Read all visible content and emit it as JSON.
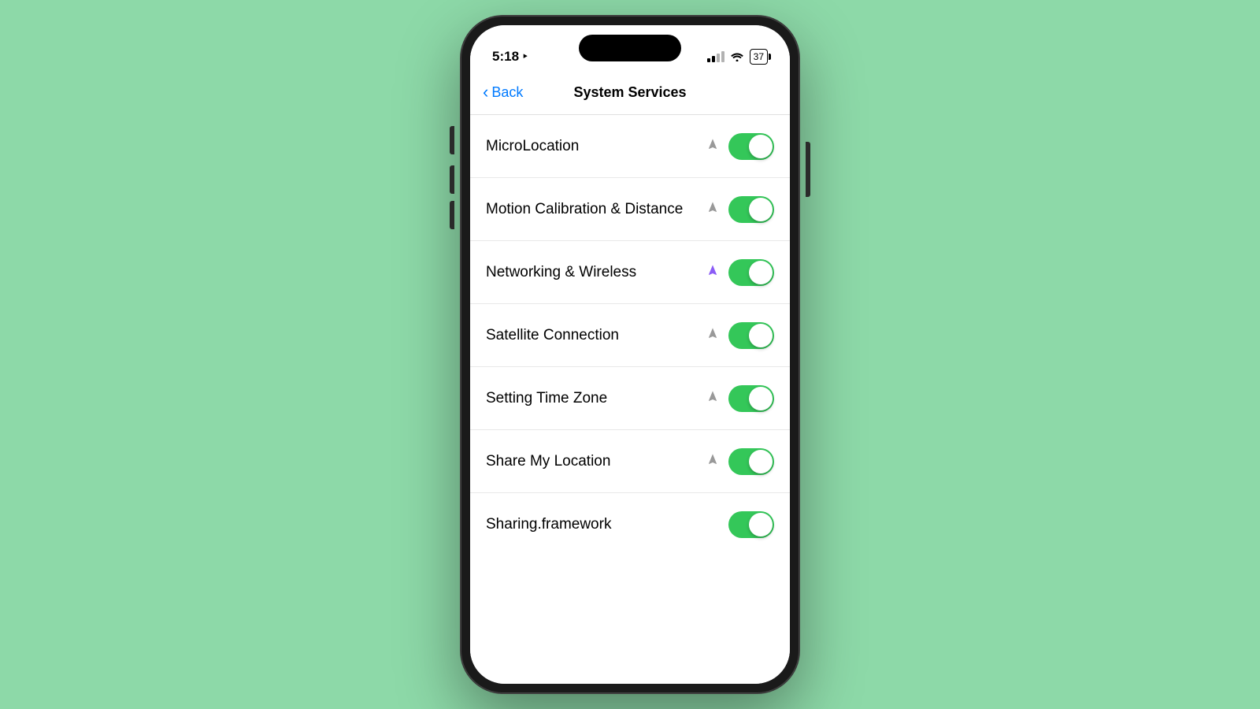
{
  "background_color": "#8dd9a8",
  "phone": {
    "status_bar": {
      "time": "5:18",
      "battery_level": "37"
    },
    "nav": {
      "back_label": "Back",
      "title": "System Services"
    },
    "settings": [
      {
        "id": "microlocation",
        "label": "MicroLocation",
        "location_active": false,
        "location_color": "gray",
        "toggle_on": true
      },
      {
        "id": "motion-calibration",
        "label": "Motion Calibration & Distance",
        "location_active": false,
        "location_color": "gray",
        "toggle_on": true
      },
      {
        "id": "networking-wireless",
        "label": "Networking & Wireless",
        "location_active": true,
        "location_color": "purple",
        "toggle_on": true
      },
      {
        "id": "satellite-connection",
        "label": "Satellite Connection",
        "location_active": false,
        "location_color": "gray",
        "toggle_on": true
      },
      {
        "id": "setting-time-zone",
        "label": "Setting Time Zone",
        "location_active": false,
        "location_color": "gray",
        "toggle_on": true
      },
      {
        "id": "share-my-location",
        "label": "Share My Location",
        "location_active": false,
        "location_color": "gray",
        "toggle_on": true
      },
      {
        "id": "sharing-framework",
        "label": "Sharing.framework",
        "location_active": false,
        "location_color": "none",
        "toggle_on": true
      }
    ]
  }
}
